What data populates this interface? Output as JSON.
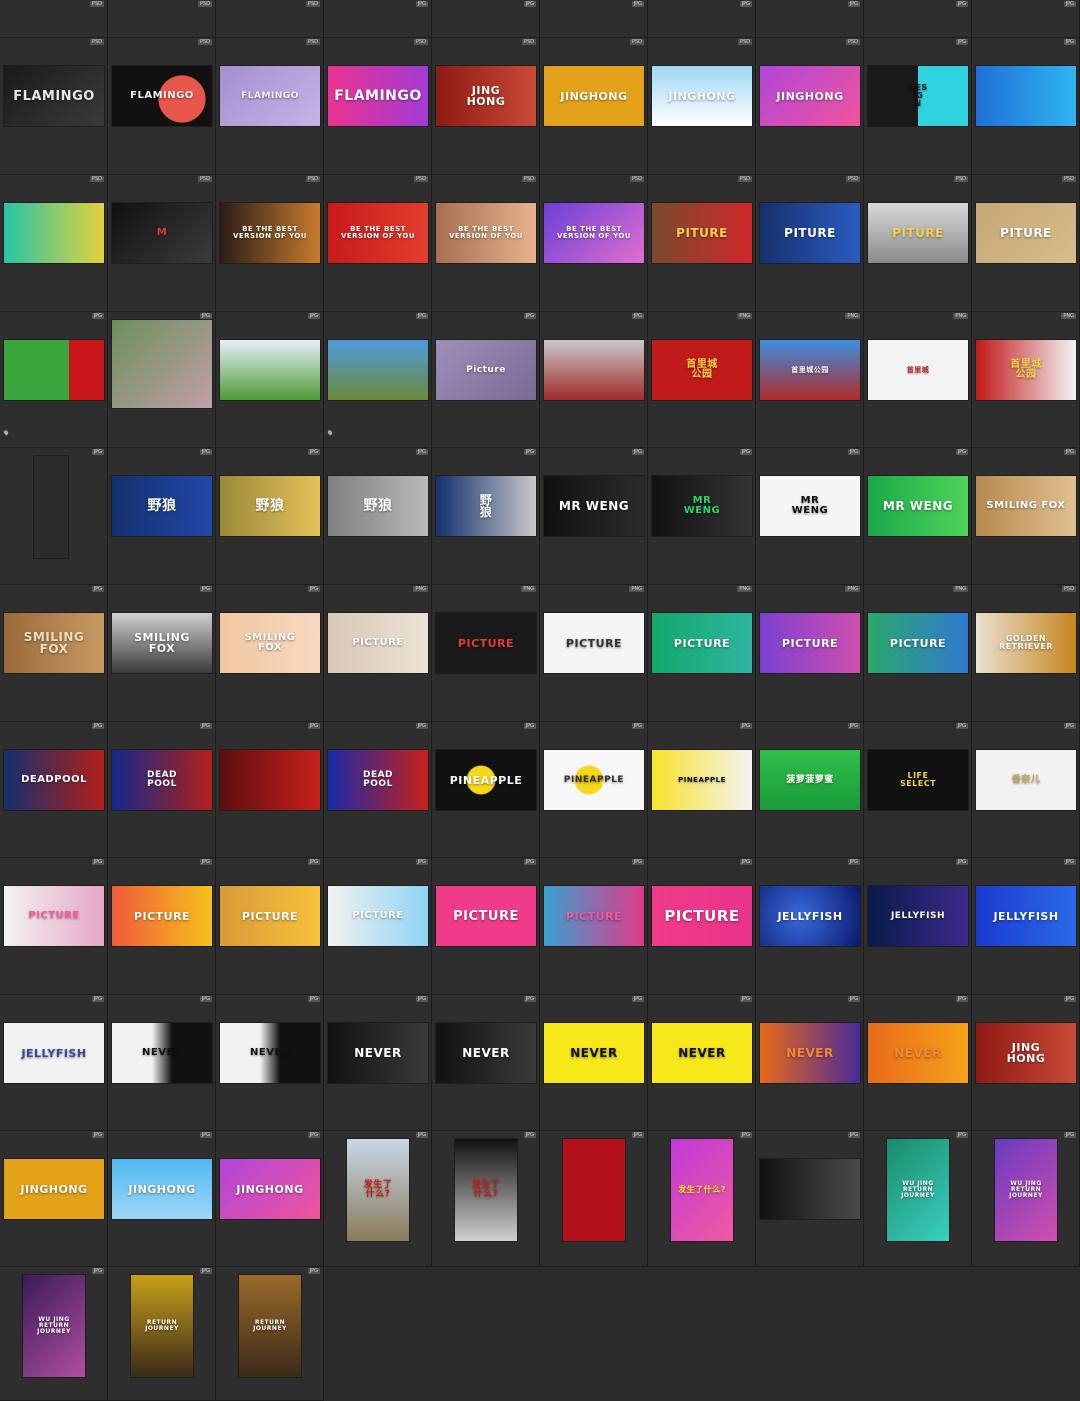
{
  "rows": [
    [
      {
        "text": "",
        "type": "PSD",
        "bg": "#2e2e2e"
      },
      {
        "text": "",
        "type": "PSD",
        "bg": "#2e2e2e"
      },
      {
        "text": "",
        "type": "PSD",
        "bg": "#2e2e2e"
      },
      {
        "text": "",
        "type": "JPG",
        "bg": "#2e2e2e"
      },
      {
        "text": "",
        "type": "JPG",
        "bg": "#2e2e2e"
      },
      {
        "text": "",
        "type": "JPG",
        "bg": "#2e2e2e"
      },
      {
        "text": "",
        "type": "JPG",
        "bg": "#2e2e2e"
      },
      {
        "text": "",
        "type": "JPG",
        "bg": "#2e2e2e"
      },
      {
        "text": "",
        "type": "JPG",
        "bg": "#2e2e2e"
      },
      {
        "text": "",
        "type": "JPG",
        "bg": "#2e2e2e"
      }
    ],
    [
      {
        "text": "FLAMINGO",
        "type": "PSD",
        "bg": "linear-gradient(135deg,#1a1a1a,#3a3a3a)",
        "fg": "#e8e8e8",
        "size": 13
      },
      {
        "text": "FLAMINGO",
        "type": "PSD",
        "bg": "radial-gradient(circle at 70% 55%,#e8574b 0 30%,#111 31%)",
        "fg": "#f2f2f2",
        "size": 10
      },
      {
        "text": "FLAMINGO",
        "type": "PSD",
        "bg": "linear-gradient(135deg,#a48fd0,#c6b3e6)",
        "fg": "#f7f0ff",
        "size": 9
      },
      {
        "text": "FLAMINGO",
        "type": "PSD",
        "bg": "linear-gradient(90deg,#e8348f,#a33ad6)",
        "fg": "#ffffff",
        "size": 14
      },
      {
        "text": "JING\nHONG",
        "type": "PSD",
        "bg": "linear-gradient(90deg,#8e1a14,#c94a38)",
        "fg": "#ffffff",
        "size": 11
      },
      {
        "text": "JINGHONG",
        "type": "PSD",
        "bg": "#e3a21a",
        "fg": "#ffffff",
        "size": 11
      },
      {
        "text": "JINGHONG",
        "type": "PSD",
        "bg": "linear-gradient(180deg,#9fd7f5,#ffffff)",
        "fg": "#ffffff",
        "size": 11
      },
      {
        "text": "JINGHONG",
        "type": "PSD",
        "bg": "linear-gradient(135deg,#b046d9,#f0559c)",
        "fg": "#ffffff",
        "size": 11
      },
      {
        "text": "DES\nIG\nN",
        "type": "JPG",
        "bg": "linear-gradient(90deg,#1a1a1a 50%,#2fd3e0 50%)",
        "fg": "#111111",
        "size": 8
      },
      {
        "text": "",
        "type": "JPG",
        "bg": "linear-gradient(90deg,#1f6fd6,#2fb5f0)",
        "fg": "#ffffff",
        "size": 8
      }
    ],
    [
      {
        "text": "",
        "type": "PSD",
        "bg": "linear-gradient(90deg,#27c4a8,#e3d23a)",
        "fg": "#ffffff",
        "size": 8
      },
      {
        "text": "M",
        "type": "PSD",
        "bg": "linear-gradient(135deg,#111,#3b3b3b)",
        "fg": "#e23b3b",
        "size": 10
      },
      {
        "text": "BE THE BEST\nVERSION OF YOU",
        "type": "PSD",
        "bg": "linear-gradient(90deg,#2a1d16,#c97c2c)",
        "fg": "#ffffff",
        "size": 7
      },
      {
        "text": "BE THE BEST\nVERSION OF YOU",
        "type": "PSD",
        "bg": "linear-gradient(90deg,#c81a1a,#e23d2d)",
        "fg": "#ffffff",
        "size": 7
      },
      {
        "text": "BE THE BEST\nVERSION OF YOU",
        "type": "PSD",
        "bg": "linear-gradient(90deg,#a87052,#e6b38b)",
        "fg": "#ffffff",
        "size": 7
      },
      {
        "text": "BE THE BEST\nVERSION OF YOU",
        "type": "PSD",
        "bg": "linear-gradient(135deg,#6b3fd8,#e06fd0)",
        "fg": "#ffffff",
        "size": 7
      },
      {
        "text": "PITURE",
        "type": "PSD",
        "bg": "linear-gradient(90deg,#7a4a2e,#d0282a)",
        "fg": "#f7d24a",
        "size": 12
      },
      {
        "text": "PITURE",
        "type": "PSD",
        "bg": "linear-gradient(90deg,#15306e,#2b5cc2)",
        "fg": "#ffffff",
        "size": 12
      },
      {
        "text": "PITURE",
        "type": "PSD",
        "bg": "linear-gradient(180deg,#d9d9d9,#8a8a8a)",
        "fg": "#f7d24a",
        "size": 12
      },
      {
        "text": "PITURE",
        "type": "PSD",
        "bg": "linear-gradient(135deg,#c5a677,#d8bd8d)",
        "fg": "#ffffff",
        "size": 12
      }
    ],
    [
      {
        "text": "",
        "type": "JPG",
        "bg": "linear-gradient(90deg,#3aa63d 0 65%,#c8161a 65%)",
        "fg": "#ffffff",
        "size": 8,
        "pin": true
      },
      {
        "text": "",
        "type": "JPG",
        "bg": "linear-gradient(135deg,#6b8f5b,#c0a0a8)",
        "fg": "#ffffff",
        "size": 8,
        "tall": true
      },
      {
        "text": "",
        "type": "JPG",
        "bg": "linear-gradient(180deg,#e6f0f7,#4f9a35)",
        "fg": "#ffffff",
        "size": 8
      },
      {
        "text": "",
        "type": "JPG",
        "bg": "linear-gradient(180deg,#4f9bdc,#6a8a3a)",
        "fg": "#ffffff",
        "size": 8,
        "pin": true
      },
      {
        "text": "Picture",
        "type": "JPG",
        "bg": "linear-gradient(135deg,#9d90b8,#7a6a95)",
        "fg": "#ffffff",
        "size": 9
      },
      {
        "text": "",
        "type": "JPG",
        "bg": "linear-gradient(180deg,#c9c9c9,#a22a2a)",
        "fg": "#ffffff",
        "size": 8
      },
      {
        "text": "首里城\n公园",
        "type": "PNG",
        "bg": "#c11a1a",
        "fg": "#f7d24a",
        "size": 10
      },
      {
        "text": "首里城公园",
        "type": "PNG",
        "bg": "linear-gradient(180deg,#3c8fe0,#b22a2a)",
        "fg": "#ffffff",
        "size": 7
      },
      {
        "text": "首里城",
        "type": "PNG",
        "bg": "#f3f3f3",
        "fg": "#b22a2a",
        "size": 7
      },
      {
        "text": "首里城\n公园",
        "type": "PNG",
        "bg": "linear-gradient(90deg,#c11a1a,#f3f3f3)",
        "fg": "#f7d24a",
        "size": 10
      }
    ],
    [
      {
        "text": "",
        "type": "JPG",
        "bg": "#2b2b2b",
        "fg": "#ffffff",
        "size": 8,
        "strip": true
      },
      {
        "text": "野狼",
        "type": "JPG",
        "bg": "linear-gradient(90deg,#12306e,#2248a8)",
        "fg": "#ffffff",
        "size": 14
      },
      {
        "text": "野狼",
        "type": "JPG",
        "bg": "linear-gradient(90deg,#9b8a3a,#e5c15a)",
        "fg": "#ffffff",
        "size": 14
      },
      {
        "text": "野狼",
        "type": "JPG",
        "bg": "linear-gradient(90deg,#808080,#b9b9b9)",
        "fg": "#ffffff",
        "size": 14
      },
      {
        "text": "野\n狼",
        "type": "JPG",
        "bg": "linear-gradient(90deg,#12306e,#c8c8c8)",
        "fg": "#ffffff",
        "size": 12
      },
      {
        "text": "MR WENG",
        "type": "JPG",
        "bg": "linear-gradient(90deg,#111,#2b2b2b)",
        "fg": "#ffffff",
        "size": 12
      },
      {
        "text": "MR\nWENG",
        "type": "JPG",
        "bg": "linear-gradient(90deg,#111,#333)",
        "fg": "#2fd36a",
        "size": 10
      },
      {
        "text": "MR\nWENG",
        "type": "JPG",
        "bg": "#f5f5f5",
        "fg": "#111111",
        "size": 10
      },
      {
        "text": "MR WENG",
        "type": "JPG",
        "bg": "linear-gradient(90deg,#1aa84a,#4fd35a)",
        "fg": "#ffffff",
        "size": 12
      },
      {
        "text": "SMILING FOX",
        "type": "JPG",
        "bg": "linear-gradient(90deg,#b78a4f,#e0c090)",
        "fg": "#ffffff",
        "size": 10
      }
    ],
    [
      {
        "text": "SMILING\nFOX",
        "type": "JPG",
        "bg": "linear-gradient(90deg,#9a6a3c,#c89a62)",
        "fg": "#f3ddc0",
        "size": 12
      },
      {
        "text": "SMILING\nFOX",
        "type": "JPG",
        "bg": "linear-gradient(180deg,#d0d0d0,#3a3a3a)",
        "fg": "#ffffff",
        "size": 11
      },
      {
        "text": "SMILING\nFOX",
        "type": "JPG",
        "bg": "linear-gradient(90deg,#f1c7a0,#f7d9c0)",
        "fg": "#ffffff",
        "size": 10
      },
      {
        "text": "PICTURE",
        "type": "PNG",
        "bg": "linear-gradient(90deg,#d8c8b5,#ece2d6)",
        "fg": "#ffffff",
        "size": 10
      },
      {
        "text": "PICTURE",
        "type": "PNG",
        "bg": "#1a1a1a",
        "fg": "#e23b3b",
        "size": 11
      },
      {
        "text": "PICTURE",
        "type": "PNG",
        "bg": "#f5f5f5",
        "fg": "#333333",
        "size": 11
      },
      {
        "text": "PICTURE",
        "type": "PNG",
        "bg": "linear-gradient(90deg,#12a86a,#2fb5a0)",
        "fg": "#ffffff",
        "size": 11
      },
      {
        "text": "PICTURE",
        "type": "PNG",
        "bg": "linear-gradient(90deg,#7a3fd0,#d04fb0)",
        "fg": "#ffffff",
        "size": 11
      },
      {
        "text": "PICTURE",
        "type": "PNG",
        "bg": "linear-gradient(90deg,#2aa86a,#2f7ad0)",
        "fg": "#ffffff",
        "size": 11
      },
      {
        "text": "GOLDEN\nRETRIEVER",
        "type": "PSD",
        "bg": "linear-gradient(90deg,#e8e0d0,#c8861e)",
        "fg": "#ffffff",
        "size": 8
      }
    ],
    [
      {
        "text": "DEADPOOL",
        "type": "JPG",
        "bg": "linear-gradient(90deg,#13306e,#b2201a)",
        "fg": "#ffffff",
        "size": 10
      },
      {
        "text": "DEAD\nPOOL",
        "type": "JPG",
        "bg": "linear-gradient(90deg,#12288a,#b2201a)",
        "fg": "#ffffff",
        "size": 9
      },
      {
        "text": "",
        "type": "JPG",
        "bg": "linear-gradient(90deg,#5a0f0f,#c8201a)",
        "fg": "#ffffff",
        "size": 8
      },
      {
        "text": "DEAD\nPOOL",
        "type": "JPG",
        "bg": "linear-gradient(90deg,#1a2aa8,#c8201a)",
        "fg": "#ffffff",
        "size": 9
      },
      {
        "text": "PINEAPPLE",
        "type": "JPG",
        "bg": "radial-gradient(circle at 45% 50%,#f7d71a 0 22%,#111 24%)",
        "fg": "#ffffff",
        "size": 11
      },
      {
        "text": "PINEAPPLE",
        "type": "JPG",
        "bg": "radial-gradient(circle at 45% 50%,#f7d71a 0 22%,#f7f7f7 24%)",
        "fg": "#333333",
        "size": 9
      },
      {
        "text": "PINEAPPLE",
        "type": "JPG",
        "bg": "linear-gradient(90deg,#f7e32a,#f3f3f3)",
        "fg": "#111111",
        "size": 7
      },
      {
        "text": "菠萝菠萝蜜",
        "type": "JPG",
        "bg": "linear-gradient(180deg,#2fc04a,#1a9a3a)",
        "fg": "#ffffff",
        "size": 9
      },
      {
        "text": "LIFE\nSELECT",
        "type": "JPG",
        "bg": "#111111",
        "fg": "#f7d24a",
        "size": 8
      },
      {
        "text": "香奈儿",
        "type": "JPG",
        "bg": "#f2f2f2",
        "fg": "#c0a060",
        "size": 9
      }
    ],
    [
      {
        "text": "PICTURE",
        "type": "JPG",
        "bg": "linear-gradient(90deg,#f2f2f2,#e6a6c6)",
        "fg": "#f35aa0",
        "size": 10
      },
      {
        "text": "PICTURE",
        "type": "JPG",
        "bg": "linear-gradient(90deg,#f05a3a,#f7c21a)",
        "fg": "#ffffff",
        "size": 11
      },
      {
        "text": "PICTURE",
        "type": "JPG",
        "bg": "linear-gradient(90deg,#d89a3a,#f7c23a)",
        "fg": "#ffffff",
        "size": 11
      },
      {
        "text": "PICTURE",
        "type": "JPG",
        "bg": "linear-gradient(90deg,#f2f2f2,#8fd3f5)",
        "fg": "#ffffff",
        "size": 10
      },
      {
        "text": "PICTURE",
        "type": "JPG",
        "bg": "#f03a8a",
        "fg": "#ffffff",
        "size": 13
      },
      {
        "text": "PICTURE",
        "type": "JPG",
        "bg": "linear-gradient(90deg,#3aa0d0,#e03a8a)",
        "fg": "#f35aa0",
        "size": 11
      },
      {
        "text": "PICTURE",
        "type": "JPG",
        "bg": "linear-gradient(90deg,#f03a8a,#e8348a)",
        "fg": "#ffffff",
        "size": 15
      },
      {
        "text": "JELLYFISH",
        "type": "JPG",
        "bg": "radial-gradient(circle at 40% 50%,#3a6ae0,#0a1a6a)",
        "fg": "#ffffff",
        "size": 11
      },
      {
        "text": "JELLYFISH",
        "type": "JPG",
        "bg": "linear-gradient(90deg,#0a1a4a,#3a2a8a)",
        "fg": "#ffffff",
        "size": 9
      },
      {
        "text": "JELLYFISH",
        "type": "JPG",
        "bg": "linear-gradient(90deg,#1a3ad0,#2a6ae8)",
        "fg": "#ffffff",
        "size": 11
      }
    ],
    [
      {
        "text": "JELLYFISH",
        "type": "JPG",
        "bg": "#f2f2f2",
        "fg": "#3a4a9a",
        "size": 11
      },
      {
        "text": "NEVER",
        "type": "JPG",
        "bg": "linear-gradient(90deg,#f2f2f2 40%,#111 60%)",
        "fg": "#111111",
        "size": 10
      },
      {
        "text": "NEVER",
        "type": "JPG",
        "bg": "linear-gradient(90deg,#f2f2f2 40%,#111 60%)",
        "fg": "#111111",
        "size": 10
      },
      {
        "text": "NEVER",
        "type": "JPG",
        "bg": "linear-gradient(90deg,#111,#3a3a3a)",
        "fg": "#ffffff",
        "size": 12
      },
      {
        "text": "NEVER",
        "type": "JPG",
        "bg": "linear-gradient(90deg,#111,#3a3a3a)",
        "fg": "#ffffff",
        "size": 12
      },
      {
        "text": "NEVER",
        "type": "JPG",
        "bg": "#f7e81a",
        "fg": "#111111",
        "size": 12
      },
      {
        "text": "NEVER",
        "type": "JPG",
        "bg": "#f7e81a",
        "fg": "#111111",
        "size": 12
      },
      {
        "text": "NEVER",
        "type": "JPG",
        "bg": "linear-gradient(90deg,#e86a1a,#4a2a9a)",
        "fg": "#f28a3a",
        "size": 12
      },
      {
        "text": "NEVER",
        "type": "JPG",
        "bg": "linear-gradient(90deg,#e86a1a,#f7a21a)",
        "fg": "#f28a3a",
        "size": 12
      },
      {
        "text": "JING\nHONG",
        "type": "JPG",
        "bg": "linear-gradient(90deg,#8e1a14,#c94a38)",
        "fg": "#ffffff",
        "size": 11
      }
    ],
    [
      {
        "text": "JINGHONG",
        "type": "JPG",
        "bg": "#e3a21a",
        "fg": "#ffffff",
        "size": 11
      },
      {
        "text": "JINGHONG",
        "type": "JPG",
        "bg": "linear-gradient(180deg,#4fb8f0,#9fd7f5)",
        "fg": "#ffffff",
        "size": 11
      },
      {
        "text": "JINGHONG",
        "type": "JPG",
        "bg": "linear-gradient(135deg,#b046d9,#f0559c)",
        "fg": "#ffffff",
        "size": 11
      },
      {
        "text": "发生了\n什么?",
        "type": "JPG",
        "bg": "linear-gradient(180deg,#c8d8e8,#8a7a5a)",
        "fg": "#c81a1a",
        "size": 9,
        "portrait": true
      },
      {
        "text": "发生了\n什么?",
        "type": "JPG",
        "bg": "linear-gradient(180deg,#111,#d0d0d0)",
        "fg": "#c81a1a",
        "size": 9,
        "portrait": true
      },
      {
        "text": "",
        "type": "JPG",
        "bg": "#b2101a",
        "fg": "#ffffff",
        "size": 8,
        "portrait": true
      },
      {
        "text": "发生了什么?",
        "type": "JPG",
        "bg": "linear-gradient(135deg,#c03ad8,#f05aa0)",
        "fg": "#f7e81a",
        "size": 8,
        "portrait": true
      },
      {
        "text": "",
        "type": "JPG",
        "bg": "linear-gradient(90deg,#111,#4a4a4a)",
        "fg": "#f7d24a",
        "size": 8,
        "small": true
      },
      {
        "text": "WU JING\nRETURN JOURNEY",
        "type": "JPG",
        "bg": "linear-gradient(135deg,#1a8a6a,#3ad0c0)",
        "fg": "#ffffff",
        "size": 6,
        "portrait": true
      },
      {
        "text": "WU JING\nRETURN JOURNEY",
        "type": "JPG",
        "bg": "linear-gradient(135deg,#6a3ac0,#d04fb0)",
        "fg": "#ffffff",
        "size": 6,
        "portrait": true
      }
    ],
    [
      {
        "text": "WU JING\nRETURN JOURNEY",
        "type": "JPG",
        "bg": "linear-gradient(135deg,#3a1a5a,#b04fa0)",
        "fg": "#ffffff",
        "size": 6,
        "portrait": true
      },
      {
        "text": "RETURN JOURNEY",
        "type": "JPG",
        "bg": "linear-gradient(180deg,#c8a01a,#3a2a1a)",
        "fg": "#ffffff",
        "size": 6,
        "portrait": true
      },
      {
        "text": "RETURN JOURNEY",
        "type": "JPG",
        "bg": "linear-gradient(180deg,#9a6a2a,#3a2a1a)",
        "fg": "#ffffff",
        "size": 6,
        "portrait": true
      }
    ]
  ]
}
